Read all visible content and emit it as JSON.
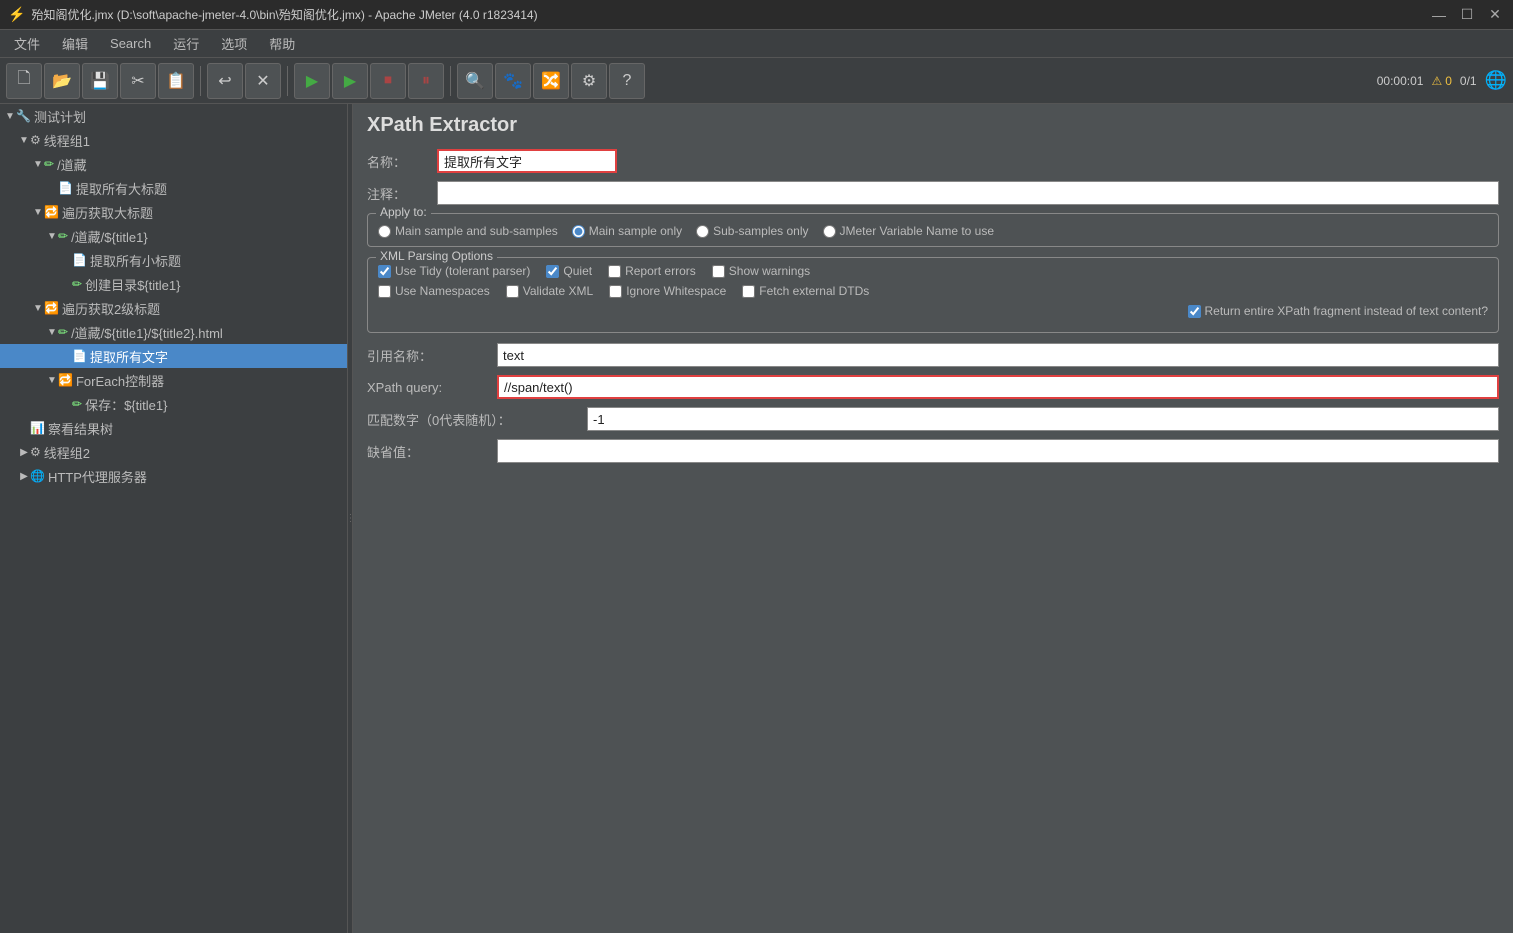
{
  "titlebar": {
    "title": "殆知阁优化.jmx (D:\\soft\\apache-jmeter-4.0\\bin\\殆知阁优化.jmx) - Apache JMeter (4.0 r1823414)",
    "icon": "⚡",
    "minimize": "—",
    "maximize": "☐",
    "close": "✕"
  },
  "menubar": {
    "items": [
      "文件",
      "编辑",
      "Search",
      "运行",
      "选项",
      "帮助"
    ]
  },
  "toolbar": {
    "buttons": [
      {
        "icon": "🖥",
        "name": "new-btn"
      },
      {
        "icon": "📂",
        "name": "open-btn"
      },
      {
        "icon": "💾",
        "name": "save-btn"
      },
      {
        "icon": "✂",
        "name": "cut-btn"
      },
      {
        "icon": "📋",
        "name": "copy-btn"
      },
      {
        "icon": "✂",
        "name": "paste-btn"
      },
      {
        "icon": "↩",
        "name": "undo-btn"
      },
      {
        "icon": "✕",
        "name": "clear-btn"
      },
      {
        "icon": "▶",
        "name": "start-btn"
      },
      {
        "icon": "▶",
        "name": "start-no-pause-btn"
      },
      {
        "icon": "⏸",
        "name": "pause-btn"
      },
      {
        "icon": "⏹",
        "name": "stop-btn"
      },
      {
        "icon": "🔍",
        "name": "search-btn"
      },
      {
        "icon": "🐾",
        "name": "debug-btn"
      },
      {
        "icon": "🔀",
        "name": "remote-btn"
      },
      {
        "icon": "⚙",
        "name": "settings-btn"
      },
      {
        "icon": "?",
        "name": "help-btn"
      }
    ],
    "time": "00:00:01",
    "warn_icon": "⚠",
    "warn_count": "0",
    "ratio": "0/1",
    "globe": "🌐"
  },
  "sidebar": {
    "items": [
      {
        "label": "测试计划",
        "level": 0,
        "arrow": "▼",
        "icon": "🔧",
        "selected": false,
        "id": "test-plan"
      },
      {
        "label": "线程组1",
        "level": 1,
        "arrow": "▼",
        "icon": "⚙",
        "selected": false,
        "id": "thread-group-1"
      },
      {
        "label": "/道藏",
        "level": 2,
        "arrow": "▼",
        "icon": "✏",
        "selected": false,
        "id": "daozang"
      },
      {
        "label": "提取所有大标题",
        "level": 3,
        "arrow": "",
        "icon": "📄",
        "selected": false,
        "id": "extract-big-titles"
      },
      {
        "label": "遍历获取大标题",
        "level": 2,
        "arrow": "▼",
        "icon": "🔁",
        "selected": false,
        "id": "foreach-big"
      },
      {
        "label": "/道藏/${title1}",
        "level": 3,
        "arrow": "▼",
        "icon": "✏",
        "selected": false,
        "id": "daozang-title1"
      },
      {
        "label": "提取所有小标题",
        "level": 4,
        "arrow": "",
        "icon": "📄",
        "selected": false,
        "id": "extract-small"
      },
      {
        "label": "创建目录${title1}",
        "level": 4,
        "arrow": "",
        "icon": "✏",
        "selected": false,
        "id": "create-dir"
      },
      {
        "label": "遍历获取2级标题",
        "level": 2,
        "arrow": "▼",
        "icon": "🔁",
        "selected": false,
        "id": "foreach-sub"
      },
      {
        "label": "/道藏/${title1}/${title2}.html",
        "level": 3,
        "arrow": "▼",
        "icon": "✏",
        "selected": false,
        "id": "daozang-title2"
      },
      {
        "label": "提取所有文字",
        "level": 4,
        "arrow": "",
        "icon": "📄",
        "selected": true,
        "id": "extract-text"
      },
      {
        "label": "ForEach控制器",
        "level": 3,
        "arrow": "▼",
        "icon": "🔁",
        "selected": false,
        "id": "foreach-ctrl"
      },
      {
        "label": "保存：${title1}",
        "level": 4,
        "arrow": "",
        "icon": "✏",
        "selected": false,
        "id": "save-title1"
      },
      {
        "label": "察看结果树",
        "level": 1,
        "arrow": "",
        "icon": "📊",
        "selected": false,
        "id": "results-tree"
      },
      {
        "label": "线程组2",
        "level": 1,
        "arrow": "▶",
        "icon": "⚙",
        "selected": false,
        "id": "thread-group-2"
      },
      {
        "label": "HTTP代理服务器",
        "level": 1,
        "arrow": "▶",
        "icon": "🌐",
        "selected": false,
        "id": "http-proxy"
      }
    ]
  },
  "content": {
    "title": "XPath Extractor",
    "name_label": "名称：",
    "name_value": "提取所有文字",
    "comment_label": "注释：",
    "comment_value": "",
    "apply_to_label": "Apply to:",
    "apply_to_options": [
      {
        "label": "Main sample and sub-samples",
        "value": "main_sub",
        "checked": false
      },
      {
        "label": "Main sample only",
        "value": "main_only",
        "checked": true
      },
      {
        "label": "Sub-samples only",
        "value": "sub_only",
        "checked": false
      },
      {
        "label": "JMeter Variable Name to use",
        "value": "variable",
        "checked": false
      }
    ],
    "xml_options_title": "XML Parsing Options",
    "checkboxes_row1": [
      {
        "label": "Use Tidy (tolerant parser)",
        "checked": true
      },
      {
        "label": "Quiet",
        "checked": true
      },
      {
        "label": "Report errors",
        "checked": false
      },
      {
        "label": "Show warnings",
        "checked": false
      }
    ],
    "checkboxes_row2": [
      {
        "label": "Use Namespaces",
        "checked": false
      },
      {
        "label": "Validate XML",
        "checked": false
      },
      {
        "label": "Ignore Whitespace",
        "checked": false
      },
      {
        "label": "Fetch external DTDs",
        "checked": false
      }
    ],
    "return_checkbox_label": "Return entire XPath fragment instead of text content?",
    "return_checked": true,
    "ref_name_label": "引用名称：",
    "ref_name_value": "text",
    "xpath_label": "XPath query:",
    "xpath_value": "//span/text()",
    "match_label": "匹配数字（0代表随机）：",
    "match_value": "-1",
    "default_label": "缺省值：",
    "default_value": ""
  }
}
